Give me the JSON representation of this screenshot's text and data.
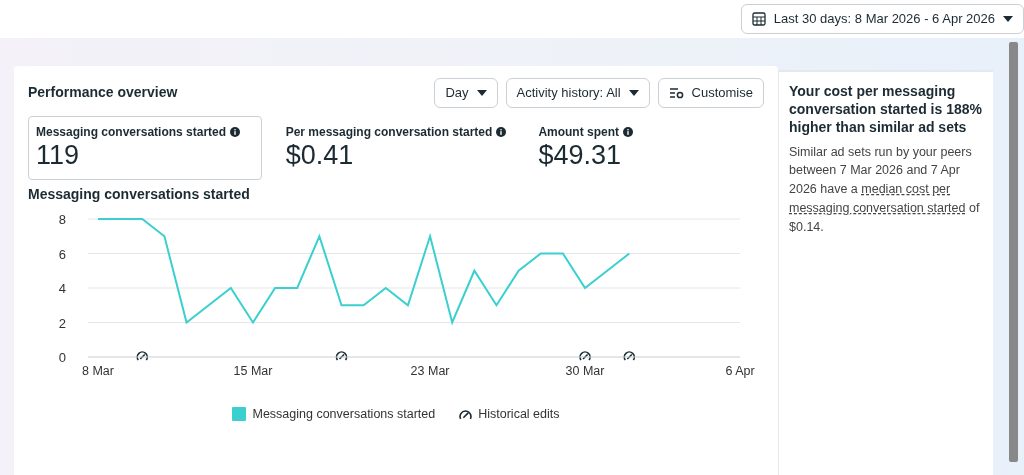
{
  "date_range": {
    "label": "Last 30 days: 8 Mar 2026 - 6 Apr 2026"
  },
  "panel": {
    "title": "Performance overview",
    "controls": [
      {
        "label": "Day",
        "kind": "dropdown"
      },
      {
        "label": "Activity history: All",
        "kind": "dropdown"
      },
      {
        "label": "Customise",
        "kind": "customise"
      }
    ],
    "metrics": [
      {
        "label": "Messaging conversations started",
        "value": "119",
        "selected": true
      },
      {
        "label": "Per messaging conversation started",
        "value": "$0.41",
        "selected": false
      },
      {
        "label": "Amount spent",
        "value": "$49.31",
        "selected": false
      }
    ],
    "chart_title": "Messaging conversations started",
    "chart_data": {
      "type": "line",
      "categories": [
        "8 Mar",
        null,
        null,
        null,
        null,
        null,
        null,
        "15 Mar",
        null,
        null,
        null,
        null,
        null,
        null,
        null,
        "23 Mar",
        null,
        null,
        null,
        null,
        null,
        null,
        "30 Mar",
        null,
        null,
        null,
        null,
        null,
        null,
        "6 Apr"
      ],
      "series": [
        {
          "name": "Messaging conversations started",
          "color": "#3ccfcf",
          "values": [
            8,
            8,
            8,
            7,
            2,
            3,
            4,
            2,
            4,
            4,
            7,
            3,
            3,
            4,
            3,
            7,
            2,
            5,
            3,
            5,
            6,
            6,
            4,
            5,
            6,
            null,
            null,
            null,
            null,
            null
          ]
        }
      ],
      "ylim": [
        0,
        8
      ],
      "yticks": [
        0,
        2,
        4,
        6,
        8
      ],
      "grid": true
    },
    "day_markers": [
      {
        "edited": false
      },
      {
        "edited": false
      },
      {
        "edited": true
      },
      {
        "edited": false
      },
      {
        "edited": false
      },
      {
        "edited": false
      },
      {
        "edited": false
      },
      {
        "edited": false
      },
      {
        "edited": false
      },
      {
        "edited": false
      },
      {
        "edited": false
      },
      {
        "edited": true
      },
      {
        "edited": false
      },
      {
        "edited": false
      },
      {
        "edited": false
      },
      {
        "edited": false
      },
      {
        "edited": false
      },
      {
        "edited": false
      },
      {
        "edited": false
      },
      {
        "edited": false
      },
      {
        "edited": false
      },
      {
        "edited": false
      },
      {
        "edited": true
      },
      {
        "edited": false
      },
      {
        "edited": true
      },
      {
        "edited": false
      },
      {
        "edited": false
      },
      {
        "edited": false
      },
      {
        "edited": false
      },
      {
        "edited": false
      }
    ],
    "legend_edits": "Historical edits"
  },
  "insight": {
    "title": "Your cost per messaging conversation started is 188% higher than similar ad sets",
    "text_before": "Similar ad sets run by your peers between 7 Mar 2026 and 7 Apr 2026 have a ",
    "link_lines": [
      "median cost per",
      "messaging conversation started"
    ],
    "text_after": " of $0.14."
  }
}
